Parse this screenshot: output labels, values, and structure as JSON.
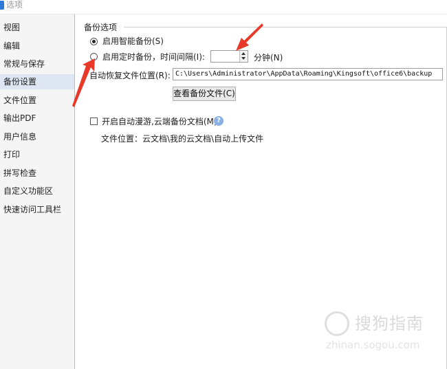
{
  "window": {
    "title": "选项"
  },
  "sidebar": {
    "items": [
      {
        "label": "视图",
        "active": false
      },
      {
        "label": "编辑",
        "active": false
      },
      {
        "label": "常规与保存",
        "active": false
      },
      {
        "label": "备份设置",
        "active": true
      },
      {
        "label": "文件位置",
        "active": false
      },
      {
        "label": "输出PDF",
        "active": false
      },
      {
        "label": "用户信息",
        "active": false
      },
      {
        "label": "打印",
        "active": false
      },
      {
        "label": "拼写检查",
        "active": false
      },
      {
        "label": "自定义功能区",
        "active": false
      },
      {
        "label": "快速访问工具栏",
        "active": false
      }
    ]
  },
  "backup": {
    "group_title": "备份选项",
    "smart_backup_label": "启用智能备份(S)",
    "smart_backup_selected": true,
    "timed_backup_label": "启用定时备份，时间间隔(I):",
    "timed_backup_selected": false,
    "interval_value": "",
    "minutes_label": "分钟(N)",
    "recovery_location_label": "自动恢复文件位置(R):",
    "recovery_location_value": "C:\\Users\\Administrator\\AppData\\Roaming\\Kingsoft\\office6\\backup",
    "view_backup_button": "查看备份文件(C)"
  },
  "roaming": {
    "checkbox_label": "开启自动漫游,云端备份文档(M)",
    "checked": false,
    "help_icon": "?",
    "file_location_text": "文件位置：云文档\\我的云文档\\自动上传文件"
  },
  "watermark": {
    "title": "搜狗指南",
    "subtitle": "zhinan.sogou.com"
  },
  "colors": {
    "annotation_arrow": "#e8392b",
    "active_nav": "#dde6f2",
    "help_icon": "#8ab0e8"
  }
}
